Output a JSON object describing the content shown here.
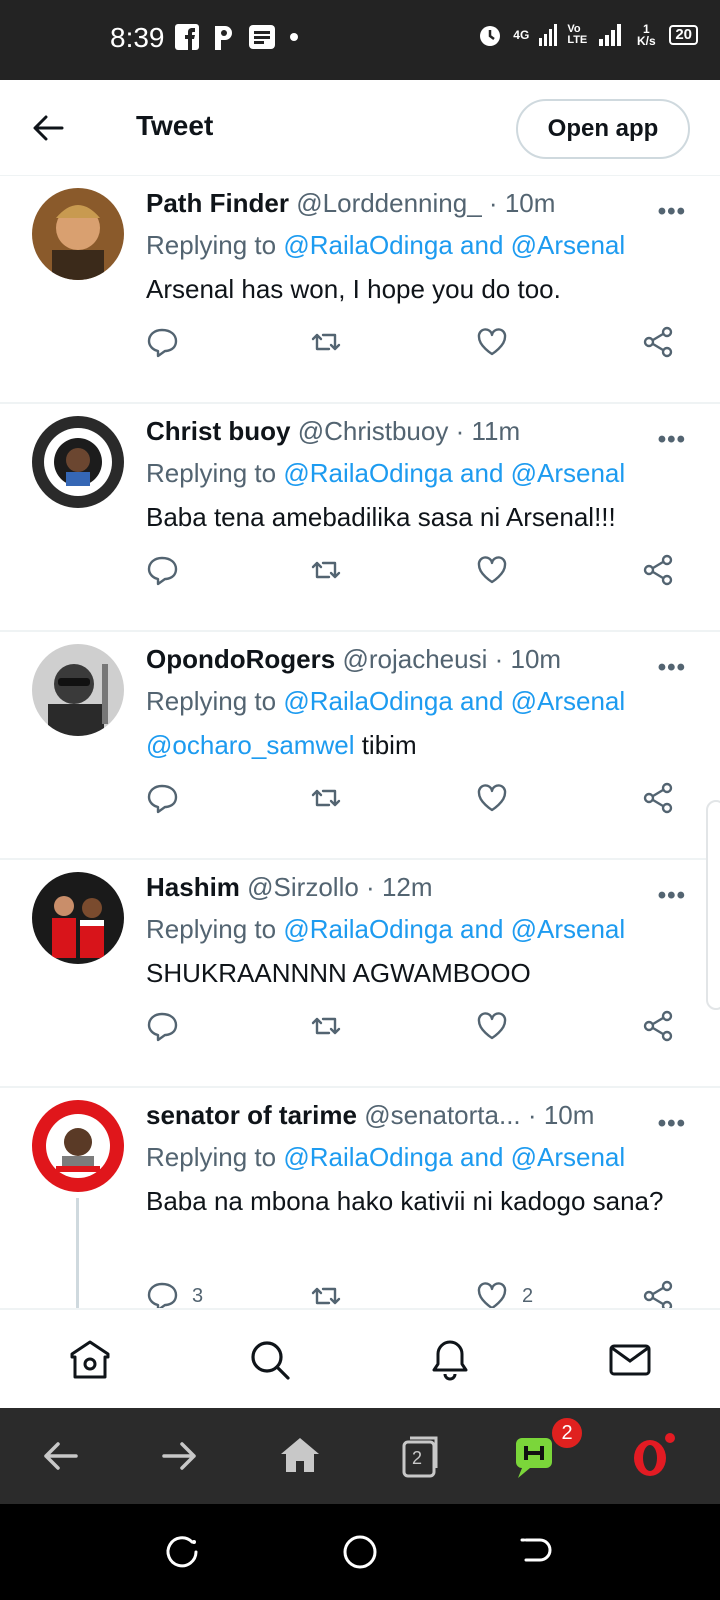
{
  "status_bar": {
    "time": "8:39",
    "battery": "20",
    "network": "4G",
    "speed": "1 K/s",
    "volte": "Vo LTE"
  },
  "header": {
    "title": "Tweet",
    "open_app": "Open app"
  },
  "tweets": [
    {
      "name": "Path Finder",
      "handle": "@Lorddenning_",
      "sep": "·",
      "time": "10m",
      "reply_prefix": "Replying to",
      "mentions": "@RailaOdinga and @Arsenal",
      "text_mention": "",
      "text": "Arsenal has won, I hope you do too.",
      "reply_count": "",
      "like_count": ""
    },
    {
      "name": "Christ buoy",
      "handle": "@Christbuoy",
      "sep": "·",
      "time": "11m",
      "reply_prefix": "Replying to",
      "mentions": "@RailaOdinga and @Arsenal",
      "text_mention": "",
      "text": "Baba tena amebadilika sasa ni Arsenal!!!",
      "reply_count": "",
      "like_count": ""
    },
    {
      "name": "OpondoRogers",
      "handle": "@rojacheusi",
      "sep": "·",
      "time": "10m",
      "reply_prefix": "Replying to",
      "mentions": "@RailaOdinga and @Arsenal",
      "text_mention": "@ocharo_samwel",
      "text": " tibim",
      "reply_count": "",
      "like_count": ""
    },
    {
      "name": "Hashim",
      "handle": "@Sirzollo",
      "sep": "·",
      "time": "12m",
      "reply_prefix": "Replying to",
      "mentions": "@RailaOdinga and @Arsenal",
      "text_mention": "",
      "text": "SHUKRAANNNN AGWAMBOOO",
      "reply_count": "",
      "like_count": ""
    },
    {
      "name": "senator of tarime",
      "handle": "@senatorta...",
      "sep": "·",
      "time": "10m",
      "reply_prefix": "Replying to",
      "mentions": "@RailaOdinga and @Arsenal",
      "text_mention": "",
      "text": "Baba na mbona hako kativii ni kadogo sana?",
      "reply_count": "3",
      "like_count": "2"
    }
  ],
  "bottom_nav": [
    "home-icon",
    "search-icon",
    "bell-icon",
    "mail-icon"
  ],
  "browser_bar": {
    "tabs_count": "2",
    "notif_badge": "2"
  },
  "colors": {
    "accent": "#1d9bf0",
    "muted": "#536471",
    "text": "#0f1419"
  }
}
